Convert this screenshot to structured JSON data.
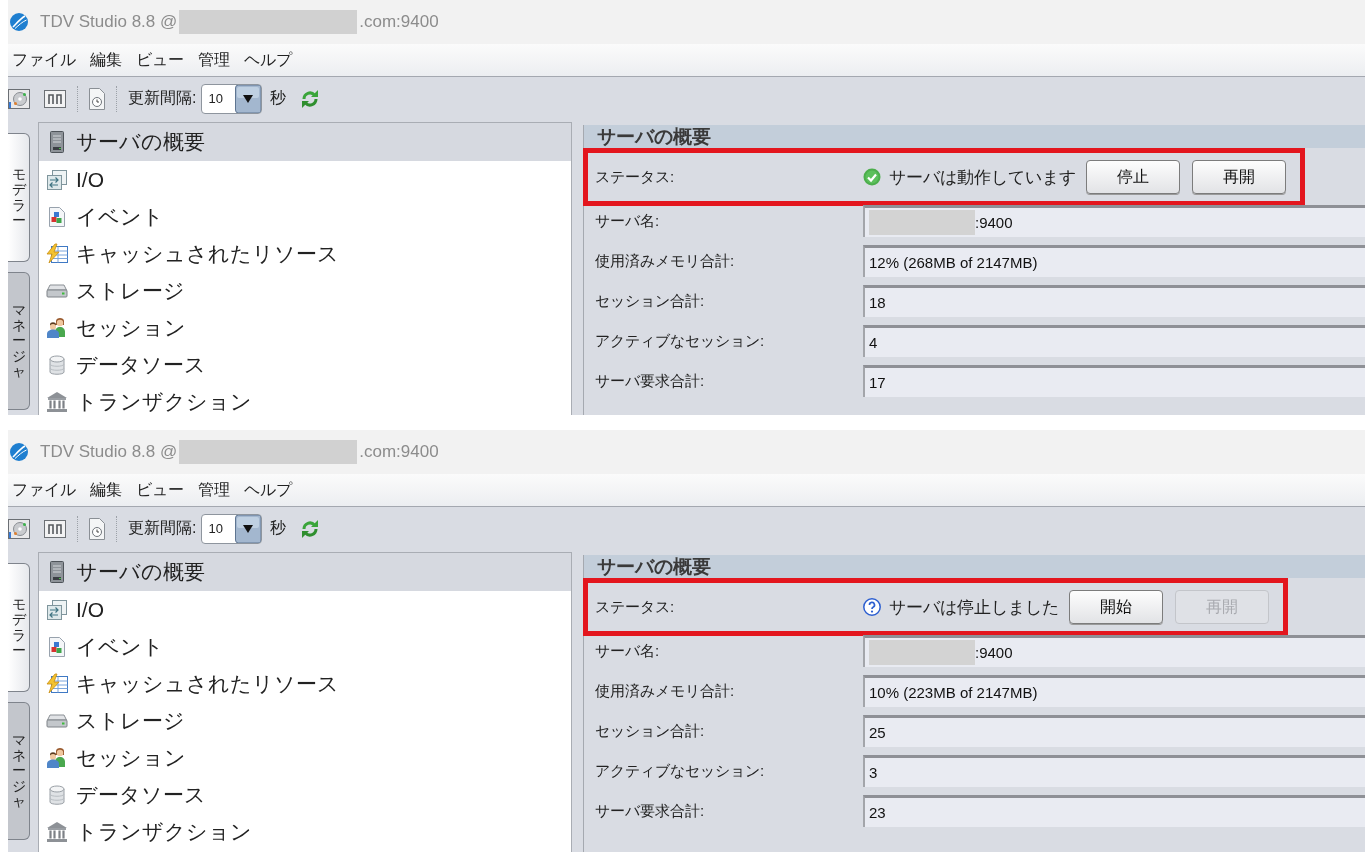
{
  "screens": [
    {
      "window": {
        "title": "TDV Studio 8.8 @",
        "redacted": true,
        "host_suffix": ".com:9400"
      },
      "menu": [
        "ファイル",
        "編集",
        "ビュー",
        "管理",
        "ヘルプ"
      ],
      "toolbar": {
        "interval_label": "更新間隔:",
        "interval": "10",
        "unit": "秒"
      },
      "side_tabs": [
        {
          "label": "モデラー",
          "selected": true
        },
        {
          "label": "マネージャ",
          "selected": false
        }
      ],
      "tree": {
        "header": "サーバの概要",
        "items": [
          {
            "kind": "io",
            "label": "I/O"
          },
          {
            "kind": "event",
            "label": "イベント"
          },
          {
            "kind": "cache",
            "label": "キャッシュされたリソース"
          },
          {
            "kind": "storage",
            "label": "ストレージ"
          },
          {
            "kind": "session",
            "label": "セッション"
          },
          {
            "kind": "datasource",
            "label": "データソース"
          },
          {
            "kind": "transaction",
            "label": "トランザクション"
          }
        ]
      },
      "overview": {
        "title": "サーバの概要",
        "status": {
          "label": "ステータス:",
          "kind": "running",
          "text": "サーバは動作しています",
          "highlighted": true,
          "buttons": [
            {
              "label": "停止",
              "disabled": false
            },
            {
              "label": "再開",
              "disabled": false
            }
          ]
        },
        "fields": [
          {
            "label": "サーバ名:",
            "value": ":9400",
            "redacted": true
          },
          {
            "label": "使用済みメモリ合計:",
            "value": "12% (268MB of 2147MB)",
            "redacted": false
          },
          {
            "label": "セッション合計:",
            "value": "18",
            "redacted": false
          },
          {
            "label": "アクティブなセッション:",
            "value": "4",
            "redacted": false
          },
          {
            "label": "サーバ要求合計:",
            "value": "17",
            "redacted": false
          }
        ]
      }
    },
    {
      "window": {
        "title": "TDV Studio 8.8 @",
        "redacted": true,
        "host_suffix": ".com:9400"
      },
      "menu": [
        "ファイル",
        "編集",
        "ビュー",
        "管理",
        "ヘルプ"
      ],
      "toolbar": {
        "interval_label": "更新間隔:",
        "interval": "10",
        "unit": "秒"
      },
      "side_tabs": [
        {
          "label": "モデラー",
          "selected": true
        },
        {
          "label": "マネージャ",
          "selected": false
        }
      ],
      "tree": {
        "header": "サーバの概要",
        "items": [
          {
            "kind": "io",
            "label": "I/O"
          },
          {
            "kind": "event",
            "label": "イベント"
          },
          {
            "kind": "cache",
            "label": "キャッシュされたリソース"
          },
          {
            "kind": "storage",
            "label": "ストレージ"
          },
          {
            "kind": "session",
            "label": "セッション"
          },
          {
            "kind": "datasource",
            "label": "データソース"
          },
          {
            "kind": "transaction",
            "label": "トランザクション"
          }
        ]
      },
      "overview": {
        "title": "サーバの概要",
        "status": {
          "label": "ステータス:",
          "kind": "stopped",
          "text": "サーバは停止しました",
          "highlighted": true,
          "buttons": [
            {
              "label": "開始",
              "disabled": false
            },
            {
              "label": "再開",
              "disabled": true
            }
          ]
        },
        "fields": [
          {
            "label": "サーバ名:",
            "value": ":9400",
            "redacted": true
          },
          {
            "label": "使用済みメモリ合計:",
            "value": "10% (223MB of 2147MB)",
            "redacted": false
          },
          {
            "label": "セッション合計:",
            "value": "25",
            "redacted": false
          },
          {
            "label": "アクティブなセッション:",
            "value": "3",
            "redacted": false
          },
          {
            "label": "サーバ要求合計:",
            "value": "23",
            "redacted": false
          }
        ]
      }
    }
  ]
}
